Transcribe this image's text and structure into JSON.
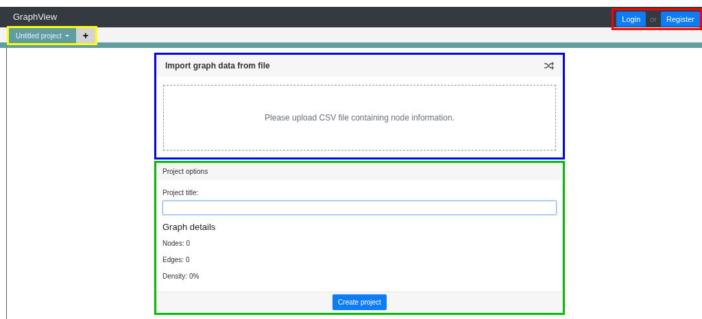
{
  "navbar": {
    "brand": "GraphView",
    "auth": [
      {
        "kind": "button",
        "label": "Login"
      },
      {
        "kind": "separator",
        "label": "or"
      },
      {
        "kind": "button",
        "label": "Register"
      }
    ]
  },
  "project_tabs": [
    {
      "kind": "dropdown",
      "label": "Untitled project",
      "selected": true
    },
    {
      "kind": "add",
      "label": "+",
      "selected": false
    }
  ],
  "import_card": {
    "title": "Import graph data from file",
    "dropzone_text": "Please upload CSV file containing node information."
  },
  "options_card": {
    "header": "Project options",
    "field": {
      "label": "Project title:",
      "focused": true
    },
    "details_title": "Graph details",
    "details": [
      "Nodes: 0",
      "Edges: 0",
      "Density: 0%"
    ],
    "submit": "Create project"
  }
}
